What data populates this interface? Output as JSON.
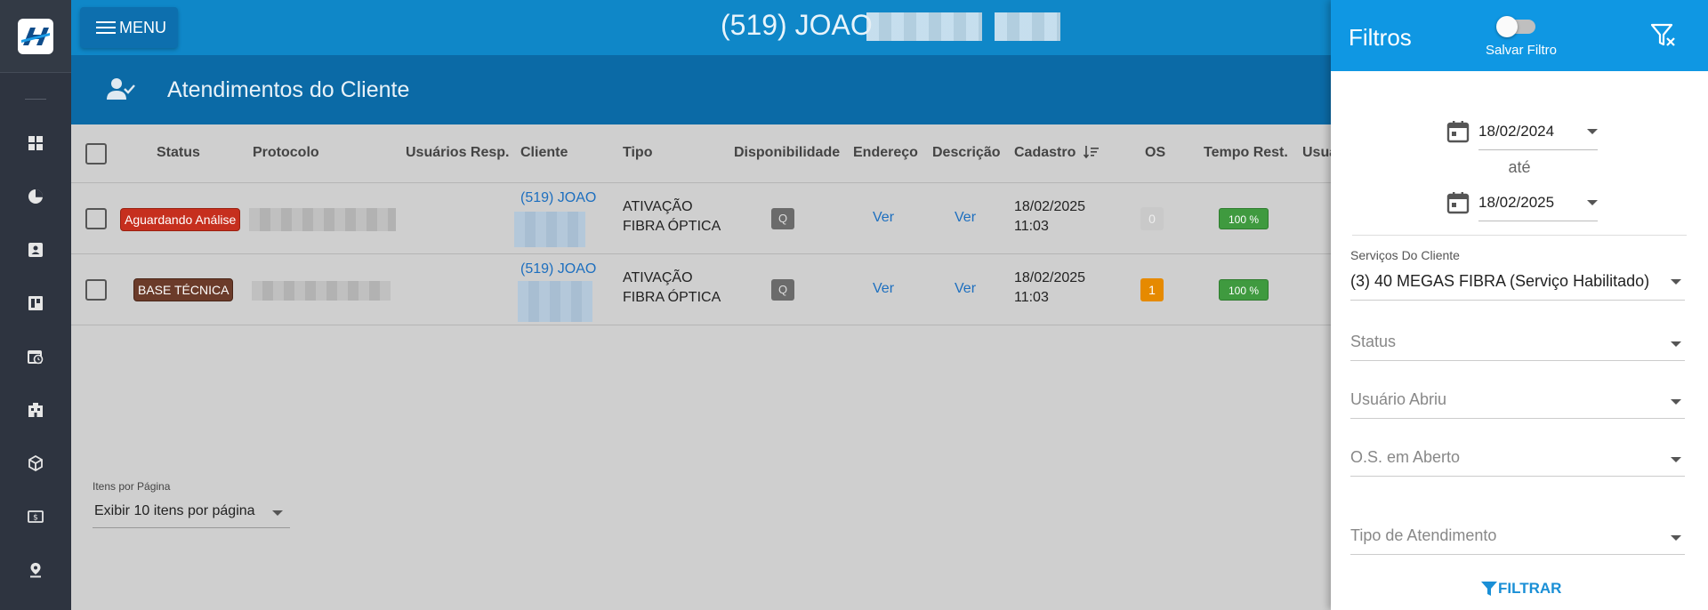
{
  "topbar": {
    "menu_label": "MENU",
    "client_title": "(519) JOAO"
  },
  "section": {
    "title": "Atendimentos do Cliente"
  },
  "table": {
    "headers": [
      "Status",
      "Protocolo",
      "Usuários Resp.",
      "Cliente",
      "Tipo",
      "Disponibilidade",
      "Endereço",
      "Descrição",
      "Cadastro",
      "OS",
      "Tempo Rest.",
      "Usuá"
    ],
    "rows": [
      {
        "status": "Aguardando Análise",
        "status_color": "#c62f1e",
        "cliente": "(519) JOAO",
        "tipo_line1": "ATIVAÇÃO",
        "tipo_line2": "FIBRA ÓPTICA",
        "disponibilidade": "Q",
        "endereco": "Ver",
        "descricao": "Ver",
        "cadastro_date": "18/02/2025",
        "cadastro_time": "11:03",
        "os": "0",
        "os_color": "#c9c9c9",
        "tempo": "100 %"
      },
      {
        "status": "BASE TÉCNICA",
        "status_color": "#6b3b2a",
        "cliente": "(519) JOAO",
        "tipo_line1": "ATIVAÇÃO",
        "tipo_line2": "FIBRA ÓPTICA",
        "disponibilidade": "Q",
        "endereco": "Ver",
        "descricao": "Ver",
        "cadastro_date": "18/02/2025",
        "cadastro_time": "11:03",
        "os": "1",
        "os_color": "#e68a00",
        "tempo": "100 %"
      }
    ]
  },
  "pager": {
    "label": "Itens por Página",
    "value": "Exibir 10 itens por página"
  },
  "filters": {
    "title": "Filtros",
    "save_filter_label": "Salvar Filtro",
    "date_from": "18/02/2024",
    "between_label": "até",
    "date_to": "18/02/2025",
    "servicos_label": "Serviços Do Cliente",
    "servicos_value": "(3) 40 MEGAS FIBRA (Serviço Habilitado)",
    "status_placeholder": "Status",
    "usuario_placeholder": "Usuário Abriu",
    "os_placeholder": "O.S. em Aberto",
    "tipo_placeholder": "Tipo de Atendimento",
    "filtrar_label": "FILTRAR"
  },
  "colors": {
    "topbar": "#0f87c8",
    "section": "#0b6aa6",
    "filter_head": "#0f97e3",
    "sidebar": "#2e3440"
  },
  "icons": [
    "logo",
    "dashboard-icon",
    "pie-chart-icon",
    "contact-card-icon",
    "board-icon",
    "calendar-clock-icon",
    "building-icon",
    "package-icon",
    "money-icon",
    "map-pin-icon",
    "user-check-icon",
    "sort-icon",
    "filter-clear-icon",
    "calendar-icon",
    "filter-icon"
  ]
}
